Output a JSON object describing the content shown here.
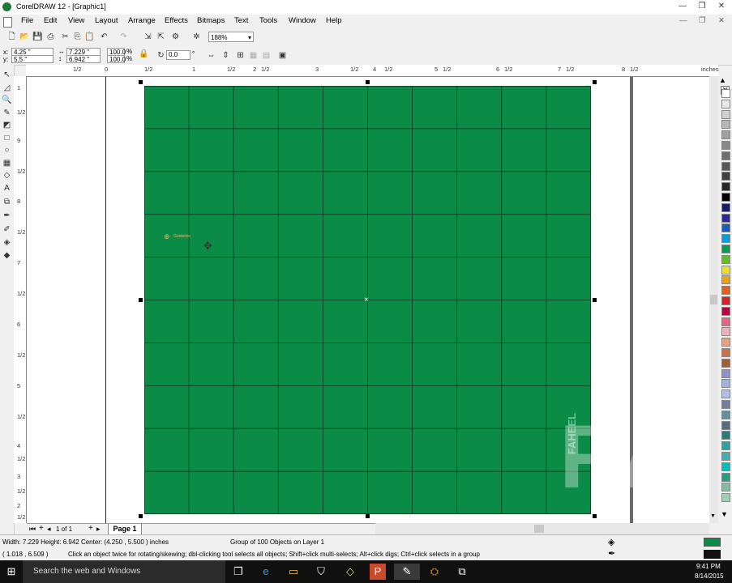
{
  "window": {
    "title": "CorelDRAW 12 - [Graphic1]"
  },
  "menu": [
    "File",
    "Edit",
    "View",
    "Layout",
    "Arrange",
    "Effects",
    "Bitmaps",
    "Text",
    "Tools",
    "Window",
    "Help"
  ],
  "toolbar": {
    "zoom": "188%"
  },
  "propertybar": {
    "x": "4.25 \"",
    "y": "5.5 \"",
    "width": "7.229 \"",
    "height": "6.942 \"",
    "scale_w": "100.0",
    "scale_h": "100.0",
    "scale_unit": "%",
    "angle": "0.0",
    "angle_unit": "°"
  },
  "ruler": {
    "units": "inches",
    "h_labels": [
      "1/2",
      "0",
      "1/2",
      "1",
      "1/2",
      "2",
      "1/2",
      "3",
      "1/2",
      "4",
      "1/2",
      "5",
      "1/2",
      "6",
      "1/2",
      "7",
      "1/2",
      "8",
      "1/2"
    ],
    "v_labels": [
      "1",
      "1/2",
      "9",
      "1/2",
      "8",
      "1/2",
      "7",
      "1/2",
      "6",
      "1/2",
      "5",
      "1/2",
      "4",
      "1/2",
      "3",
      "1/2",
      "2",
      "1/2"
    ]
  },
  "grid": {
    "rows": 10,
    "cols": 10,
    "fill": "#0a8c46",
    "line": "#0a3a20"
  },
  "canvas": {
    "guide_label": "Guideline",
    "watermark": "RA",
    "watermark_side": "FAHEEL",
    "watermark_sub": "AHMAD"
  },
  "pagetabs": {
    "counter": "1 of 1",
    "page": "Page 1"
  },
  "status": {
    "dims": "Width: 7.229  Height: 6.942  Center: (4.250 , 5.500 )  inches",
    "object": "Group of 100 Objects on Layer 1",
    "coords": "( 1.018 , 6.509 )",
    "hint": "Click an object twice for rotating/skewing; dbl-clicking tool selects all objects; Shift+click multi-selects; Alt+click digs; Ctrl+click selects in a group"
  },
  "taskbar": {
    "search_placeholder": "Search the web and Windows",
    "time": "9:41 PM",
    "date": "8/14/2015"
  },
  "colors": {
    "palette": [
      "#ffffff",
      "#e8e8e8",
      "#d0d0d0",
      "#b8b8b8",
      "#a0a0a0",
      "#888888",
      "#707070",
      "#585858",
      "#404040",
      "#282828",
      "#000000",
      "#1a1a6e",
      "#2a2aa0",
      "#1060c0",
      "#00a0e0",
      "#00a050",
      "#60c020",
      "#f0e020",
      "#f0a010",
      "#e06020",
      "#e02020",
      "#c00040",
      "#f06080",
      "#f0b0c0",
      "#e8a080",
      "#d07040",
      "#a06030",
      "#9090d0",
      "#a0b0e0",
      "#b0c0e8",
      "#7080a0",
      "#6090a0",
      "#507080",
      "#208080",
      "#30a0a0",
      "#40b0b0",
      "#00c0c0",
      "#20a080",
      "#80c0a0",
      "#a0d0b0"
    ],
    "fill_indicator": "#0a8c46"
  }
}
